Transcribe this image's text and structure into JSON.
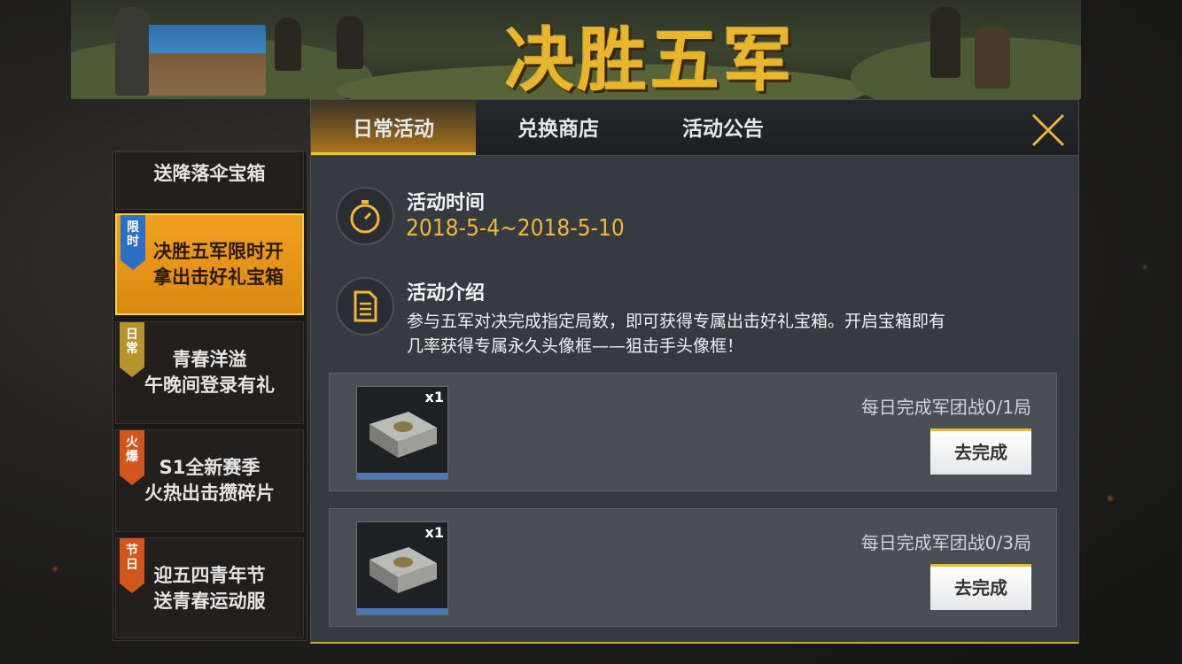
{
  "banner": {
    "title": "决胜五军"
  },
  "tabs": [
    {
      "label": "日常活动",
      "active": true
    },
    {
      "label": "兑换商店",
      "active": false
    },
    {
      "label": "活动公告",
      "active": false
    }
  ],
  "sidebar": {
    "items": [
      {
        "line1": "送降落伞宝箱",
        "line2": "",
        "badge": "",
        "active": false
      },
      {
        "line1": "决胜五军限时开",
        "line2": "拿出击好礼宝箱",
        "badge": "限时",
        "badge_color": "#2d6fc4",
        "active": true
      },
      {
        "line1": "青春洋溢",
        "line2": "午晚间登录有礼",
        "badge": "日常",
        "badge_color": "#b8922a",
        "active": false
      },
      {
        "line1": "S1全新赛季",
        "line2": "火热出击攒碎片",
        "badge": "火爆",
        "badge_color": "#d2561c",
        "active": false
      },
      {
        "line1": "迎五四青年节",
        "line2": "送青春运动服",
        "badge": "节日",
        "badge_color": "#d2561c",
        "active": false
      }
    ]
  },
  "activity": {
    "time_title": "活动时间",
    "time_value": "2018-5-4~2018-5-10",
    "intro_title": "活动介绍",
    "intro_line1": "参与五军对决完成指定局数，即可获得专属出击好礼宝箱。开启宝箱即有",
    "intro_line2": "几率获得专属永久头像框——狙击手头像框！"
  },
  "tasks": [
    {
      "qty": "x1",
      "label": "每日完成军团战0/1局",
      "button": "去完成"
    },
    {
      "qty": "x1",
      "label": "每日完成军团战0/3局",
      "button": "去完成"
    }
  ],
  "colors": {
    "accent": "#f0b83a",
    "panel": "#363a41",
    "active_item": "#f0a020"
  }
}
